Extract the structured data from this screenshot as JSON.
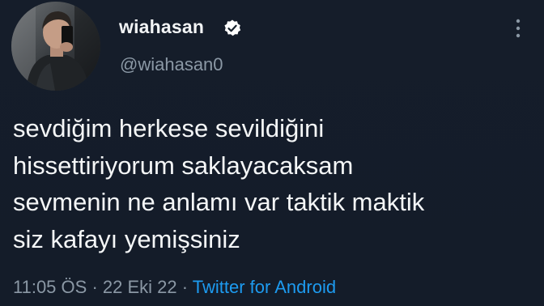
{
  "user": {
    "display_name": "wiahasan",
    "handle": "@wiahasan0",
    "verified": true
  },
  "tweet": {
    "lines": [
      "sevdiğim herkese sevildiğini",
      "hissettiriyorum saklayacaksam",
      "sevmenin ne anlamı var taktik maktik",
      "siz kafayı yemişsiniz"
    ]
  },
  "meta": {
    "time": "11:05 ÖS",
    "separator1": " · ",
    "date": "22 Eki 22",
    "separator2": " · ",
    "source": "Twitter for Android"
  },
  "colors": {
    "background": "#15202b",
    "verified_badge": "#ffffff",
    "link": "#1d9bf0",
    "secondary_text": "#8b98a5"
  },
  "icons": {
    "verified": "verified-badge-icon",
    "more": "more-vertical-icon"
  }
}
